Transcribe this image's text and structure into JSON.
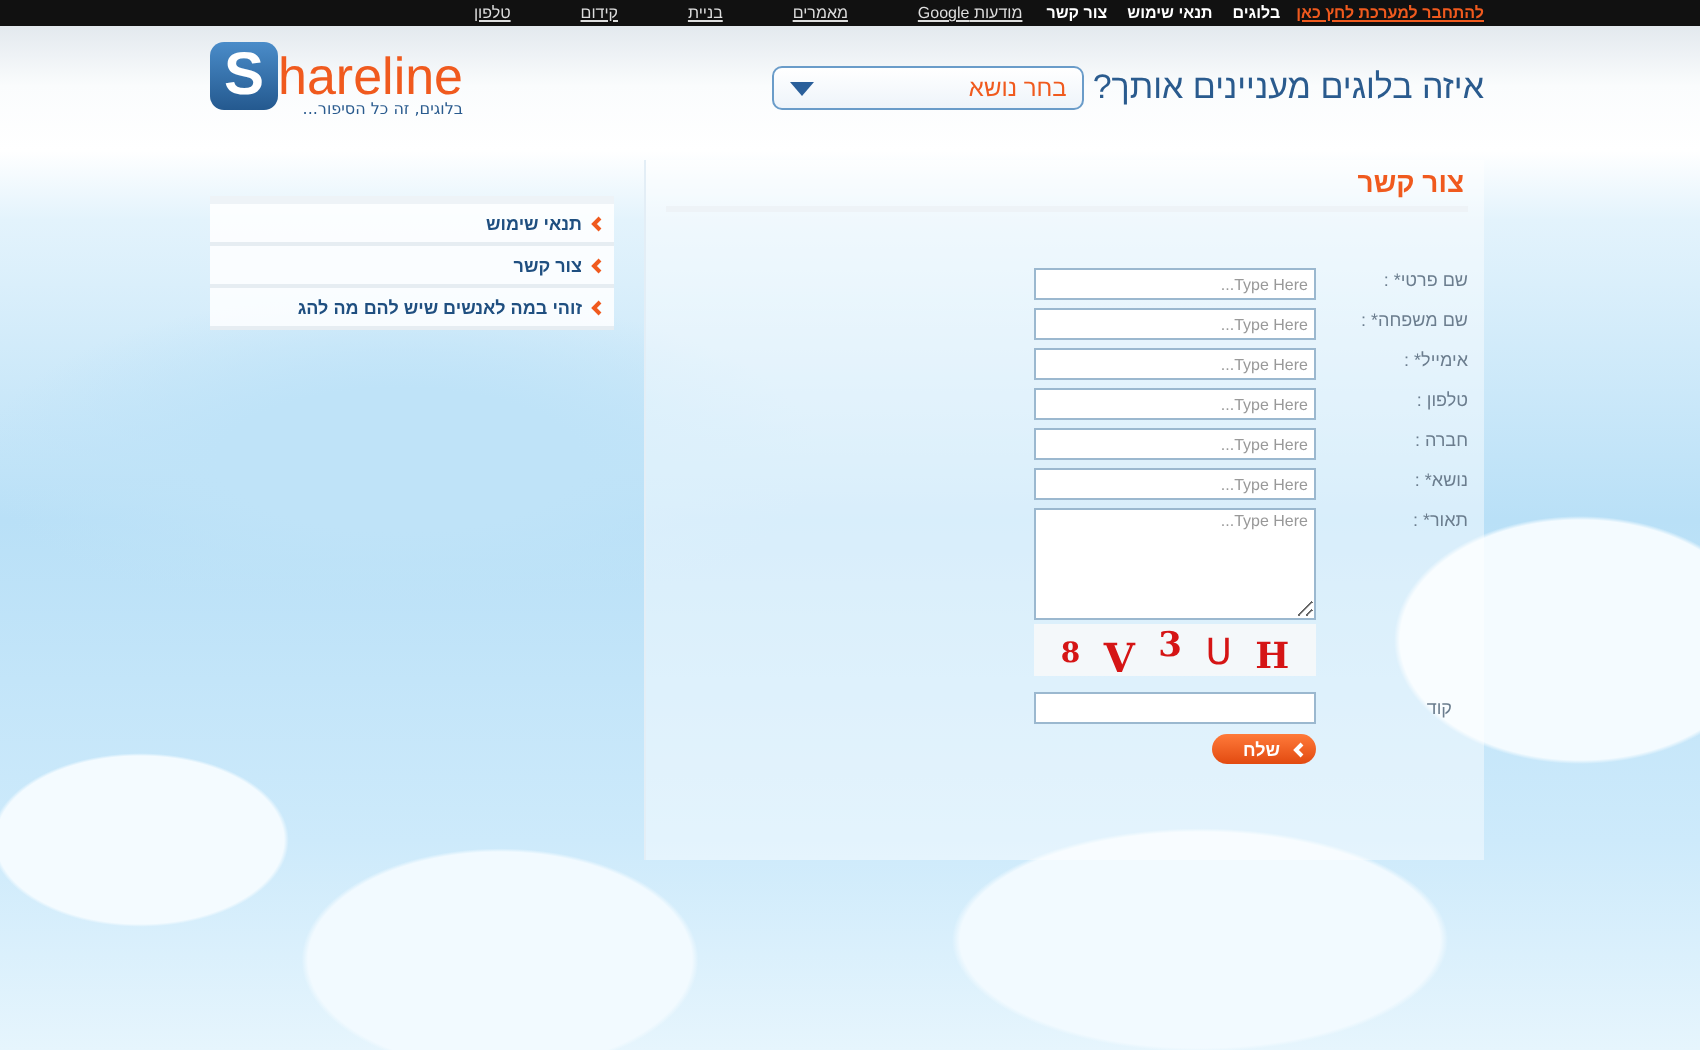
{
  "top_bar": {
    "links": [
      {
        "label": "להתחבר למערכת לחץ כאן",
        "kind": "login"
      },
      {
        "label": "בלוגים",
        "kind": "main"
      },
      {
        "label": "תנאי שימוש",
        "kind": "main"
      },
      {
        "label": "צור קשר",
        "kind": "main"
      },
      {
        "label": "מודעות Google",
        "kind": "ad"
      },
      {
        "label": "מאמרים",
        "kind": "ad"
      },
      {
        "label": "בניית",
        "kind": "ad"
      },
      {
        "label": "קידום",
        "kind": "ad"
      },
      {
        "label": "טלפון",
        "kind": "ad"
      }
    ]
  },
  "header": {
    "logo": {
      "initial": "S",
      "name": "hareline",
      "tagline": "בלוגים, זה כל הסיפור..."
    },
    "question": "איזה בלוגים מעניינים אותך?",
    "topic_select": {
      "value": "בחר נושא"
    }
  },
  "sidebar": {
    "items": [
      "תנאי שימוש",
      "צור קשר",
      "זוהי במה לאנשים שיש להם מה להג"
    ]
  },
  "contact_form": {
    "title": "צור קשר",
    "fields": [
      {
        "label": "שם פרטי* :",
        "kind": "input",
        "placeholder": "...Type Here"
      },
      {
        "label": "שם משפחה* :",
        "kind": "input",
        "placeholder": "...Type Here"
      },
      {
        "label": "אימייל* :",
        "kind": "input",
        "placeholder": "...Type Here"
      },
      {
        "label": "טלפון :",
        "kind": "input",
        "placeholder": "...Type Here"
      },
      {
        "label": "חברה :",
        "kind": "input",
        "placeholder": "...Type Here"
      },
      {
        "label": "נושא* :",
        "kind": "input",
        "placeholder": "...Type Here"
      },
      {
        "label": "תאור* :",
        "kind": "textarea",
        "placeholder": "...Type Here"
      }
    ],
    "captcha": "8 V 3 U H",
    "code_label": "קוד",
    "submit": "שלח"
  }
}
